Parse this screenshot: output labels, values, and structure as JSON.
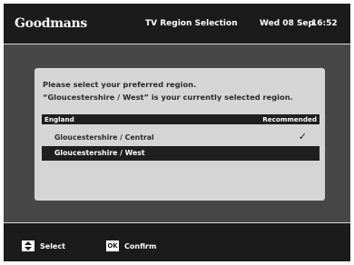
{
  "header": {
    "brand": "Goodmans",
    "title": "TV Region Selection",
    "date": "Wed 08 Sep",
    "time": "16:52"
  },
  "dialog": {
    "line1": "Please select your preferred region.",
    "line2": "“Gloucestershire / West” is your currently selected region.",
    "group": {
      "name": "England",
      "tag": "Recommended"
    },
    "options": [
      {
        "label": "Gloucestershire / Central",
        "marker": "✓"
      },
      {
        "label": "Gloucestershire / West",
        "marker": ""
      }
    ]
  },
  "footer": {
    "select_label": "Select",
    "ok_key": "OK",
    "confirm_label": "Confirm"
  }
}
